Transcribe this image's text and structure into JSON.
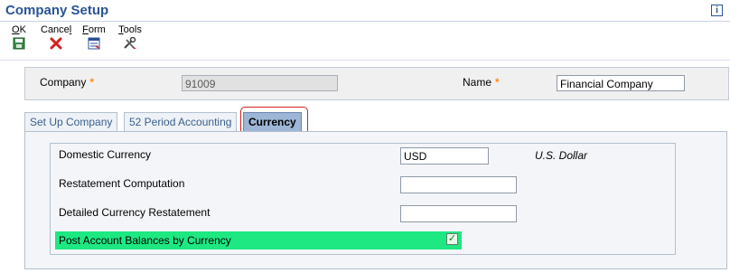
{
  "window": {
    "title": "Company Setup",
    "help_icon": "info-icon"
  },
  "toolbar": {
    "ok": {
      "label_prefix": "",
      "label_accel": "O",
      "label_rest": "K",
      "icon": "save-icon"
    },
    "cancel": {
      "label_prefix": "Cance",
      "label_accel": "l",
      "label_rest": "",
      "icon": "close-x-icon"
    },
    "form": {
      "label_prefix": "",
      "label_accel": "F",
      "label_rest": "orm",
      "icon": "form-icon"
    },
    "tools": {
      "label_prefix": "",
      "label_accel": "T",
      "label_rest": "ools",
      "icon": "tools-icon"
    }
  },
  "header": {
    "company_label": "Company",
    "company_value": "91009",
    "name_label": "Name",
    "name_value": "Financial Company",
    "required_marker": "*"
  },
  "tabs": [
    {
      "label": "Set Up Company",
      "active": false
    },
    {
      "label": "52 Period Accounting",
      "active": false
    },
    {
      "label": "Currency",
      "active": true
    }
  ],
  "currency_tab": {
    "domestic_currency_label": "Domestic Currency",
    "domestic_currency_value": "USD",
    "domestic_currency_desc": "U.S. Dollar",
    "restatement_computation_label": "Restatement Computation",
    "restatement_computation_value": "",
    "detailed_restatement_label": "Detailed Currency Restatement",
    "detailed_restatement_value": "",
    "post_balances_label": "Post Account Balances by Currency",
    "post_balances_checked": true
  },
  "colors": {
    "title": "#2a5396",
    "required_star": "#ff8c1a",
    "highlight_row": "#1de882",
    "tab_highlight": "#d42020",
    "active_tab": "#9db6d5"
  }
}
